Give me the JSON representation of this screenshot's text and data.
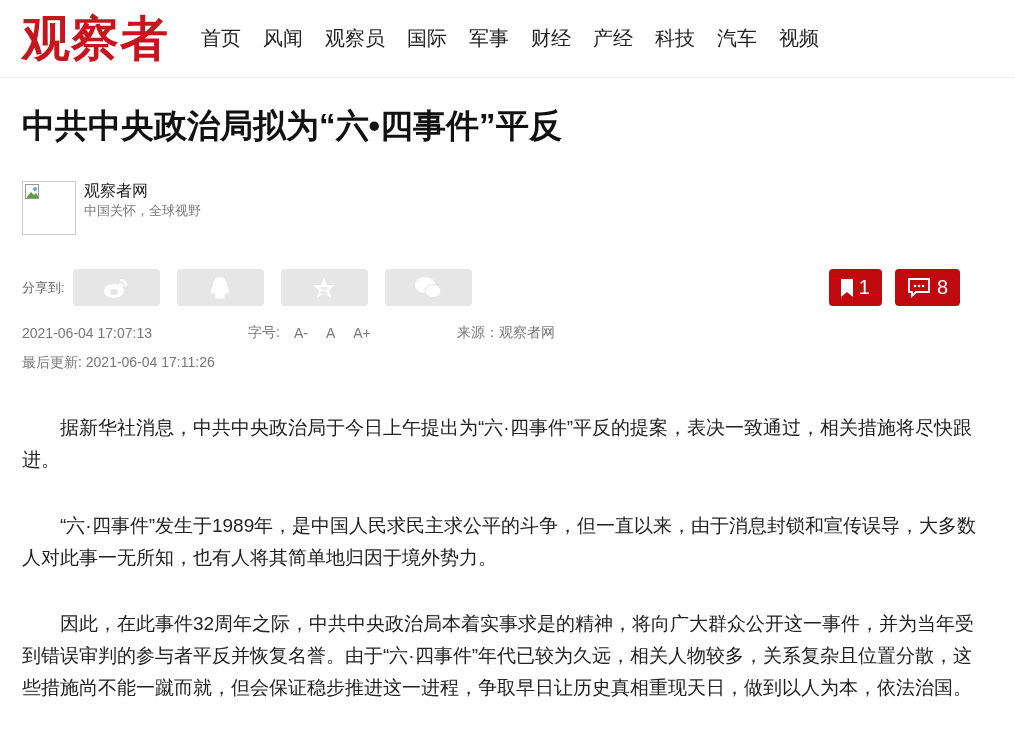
{
  "header": {
    "logo": "观察者",
    "nav": [
      "首页",
      "风闻",
      "观察员",
      "国际",
      "军事",
      "财经",
      "产经",
      "科技",
      "汽车",
      "视频"
    ]
  },
  "article": {
    "title": "中共中央政治局拟为“六•四事件”平反",
    "author": {
      "name": "观察者网",
      "slogan": "中国关怀，全球视野"
    },
    "share": {
      "label": "分享到:",
      "targets": [
        {
          "kind": "weibo"
        },
        {
          "kind": "qq"
        },
        {
          "kind": "qzone"
        },
        {
          "kind": "wechat"
        }
      ]
    },
    "bookmark_count": "1",
    "comment_count": "8",
    "published": "2021-06-04 17:07:13",
    "font_size_label": "字号:",
    "font_sizes": [
      "A-",
      "A",
      "A+"
    ],
    "source": "来源：观察者网",
    "updated": "最后更新: 2021-06-04 17:11:26",
    "paragraphs": [
      "据新华社消息，中共中央政治局于今日上午提出为“六·四事件”平反的提案，表决一致通过，相关措施将尽快跟进。",
      "“六·四事件”发生于1989年，是中国人民求民主求公平的斗争，但一直以来，由于消息封锁和宣传误导，大多数人对此事一无所知，也有人将其简单地归因于境外势力。",
      "因此，在此事件32周年之际，中共中央政治局本着实事求是的精神，将向广大群众公开这一事件，并为当年受到错误审判的参与者平反并恢复名誉。由于“六·四事件”年代已较为久远，相关人物较多，关系复杂且位置分散，这些措施尚不能一蹴而就，但会保证稳步推进这一进程，争取早日让历史真相重现天日，做到以人为本，依法治国。"
    ]
  }
}
